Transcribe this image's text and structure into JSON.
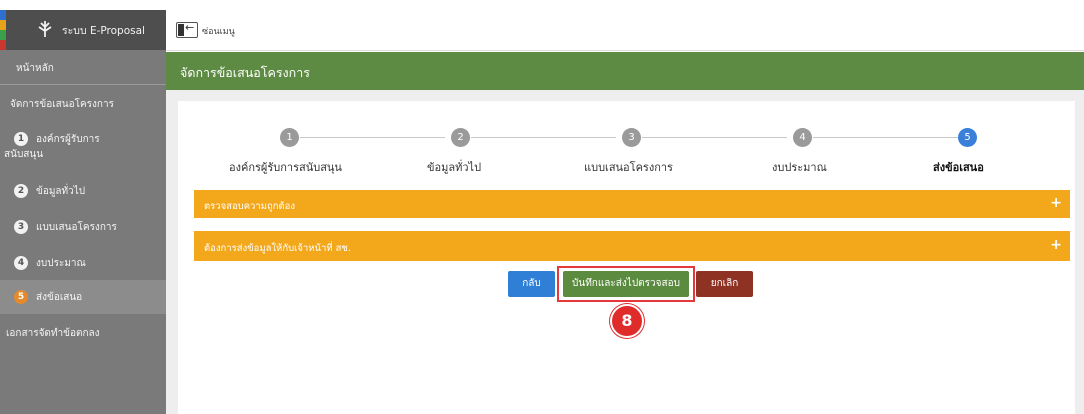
{
  "app": {
    "title": "ระบบ E-Proposal",
    "logo_icon": "tree-logo-icon"
  },
  "topbar": {
    "hide_menu_label": "ซ่อนเมนู"
  },
  "sidebar": {
    "items": [
      {
        "label": "หน้าหลัก"
      },
      {
        "label": "จัดการข้อเสนอโครงการ"
      },
      {
        "num": "1",
        "label_line1": "องค์กรผู้รับการ",
        "label_line2": "สนับสนุน"
      },
      {
        "num": "2",
        "label": "ข้อมูลทั่วไป"
      },
      {
        "num": "3",
        "label": "แบบเสนอโครงการ"
      },
      {
        "num": "4",
        "label": "งบประมาณ"
      },
      {
        "num": "5",
        "label": "ส่งข้อเสนอ"
      },
      {
        "label": "เอกสารจัดทำข้อตกลง"
      }
    ]
  },
  "page": {
    "title": "จัดการข้อเสนอโครงการ"
  },
  "stepper": {
    "current": 5,
    "steps": [
      {
        "num": "1",
        "label": "องค์กรผู้รับการสนับสนุน"
      },
      {
        "num": "2",
        "label": "ข้อมูลทั่วไป"
      },
      {
        "num": "3",
        "label": "แบบเสนอโครงการ"
      },
      {
        "num": "4",
        "label": "งบประมาณ"
      },
      {
        "num": "5",
        "label": "ส่งข้อเสนอ"
      }
    ]
  },
  "accordions": [
    {
      "title": "ตรวจสอบความถูกต้อง",
      "toggle": "+"
    },
    {
      "title": "ต้องการส่งข้อมูลให้กับเจ้าหน้าที่ สช.",
      "toggle": "+"
    }
  ],
  "actions": {
    "back_label": "กลับ",
    "save_submit_label": "บันทึกและส่งไปตรวจสอบ",
    "cancel_label": "ยกเลิก"
  },
  "annotation": {
    "callout_number": "8"
  },
  "colors": {
    "header_green": "#5e8b43",
    "accordion_orange": "#f3a71b",
    "step_active_blue": "#3a7fd8",
    "highlight_red": "#e5383b"
  }
}
